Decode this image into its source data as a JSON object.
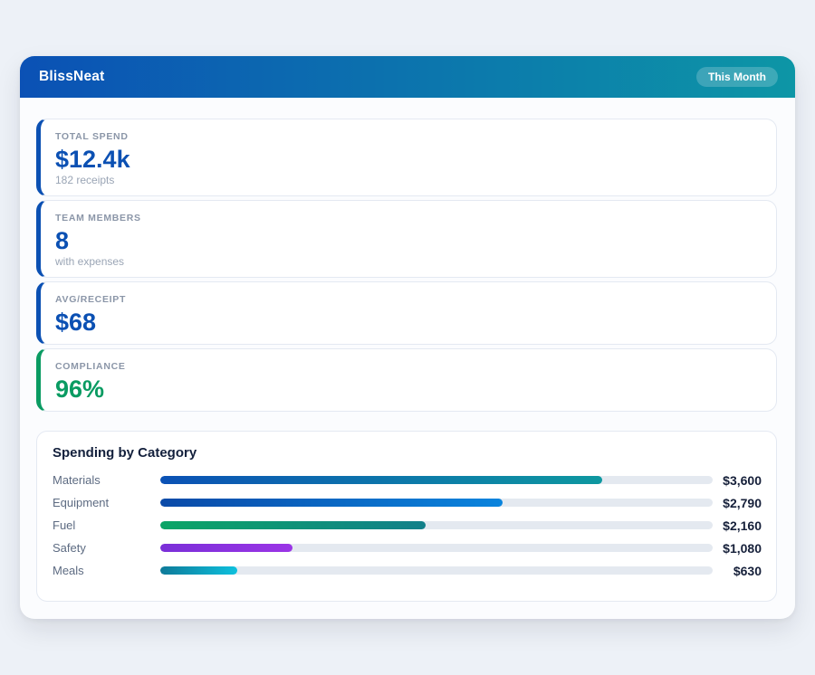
{
  "page": {
    "background": "#edf1f7"
  },
  "header": {
    "title": "BlissNeat",
    "period_badge": "This Month",
    "gradient_from": "#0b51b5",
    "gradient_to": "#0d96a6"
  },
  "stats": [
    {
      "label": "TOTAL SPEND",
      "value": "$12.4k",
      "sub": "182 receipts",
      "accent": "#0b50b3",
      "value_color": "#0b50b3"
    },
    {
      "label": "TEAM MEMBERS",
      "value": "8",
      "sub": "with expenses",
      "accent": "#0b50b3",
      "value_color": "#0b50b3"
    },
    {
      "label": "AVG/RECEIPT",
      "value": "$68",
      "sub": "",
      "accent": "#0b50b3",
      "value_color": "#0b50b3"
    },
    {
      "label": "COMPLIANCE",
      "value": "96%",
      "sub": "",
      "accent": "#0a9b62",
      "value_color": "#0a9b62"
    }
  ],
  "chart_data": {
    "type": "bar",
    "orientation": "horizontal",
    "title": "Spending by Category",
    "categories": [
      "Materials",
      "Equipment",
      "Fuel",
      "Safety",
      "Meals"
    ],
    "values": [
      3600,
      2790,
      2160,
      1080,
      630
    ],
    "value_labels": [
      "$3,600",
      "$2,790",
      "$2,160",
      "$1,080",
      "$630"
    ],
    "xlim": [
      0,
      4500
    ],
    "track_color": "#e4e9f0",
    "bar_gradients": [
      [
        "#0b51b5",
        "#0e98a0"
      ],
      [
        "#0b4aa8",
        "#0a84dd"
      ],
      [
        "#0ba566",
        "#12808a"
      ],
      [
        "#7a2fd8",
        "#9b35e6"
      ],
      [
        "#0e7a99",
        "#0ec0dd"
      ]
    ]
  }
}
